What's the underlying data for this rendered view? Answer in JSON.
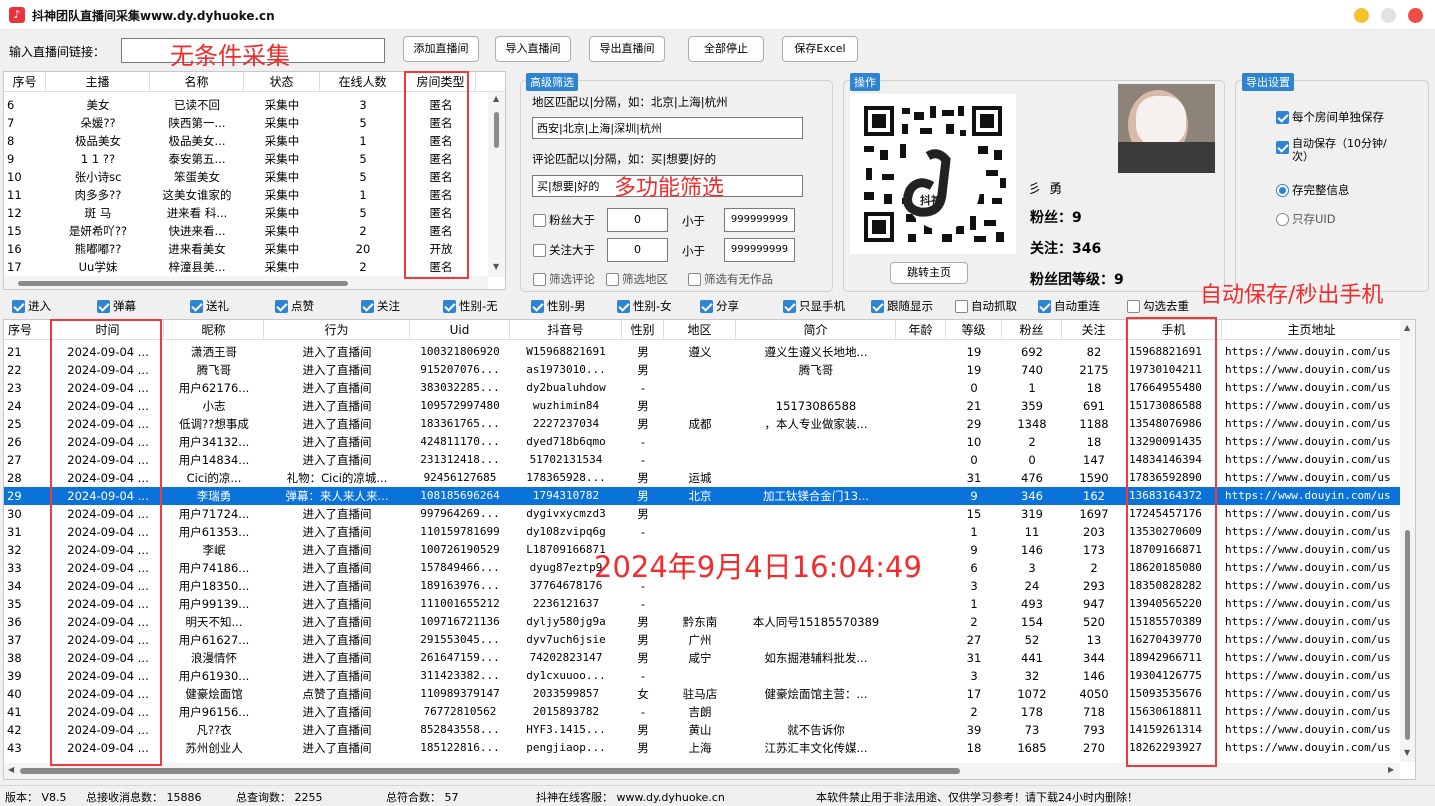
{
  "window": {
    "title": "抖神团队直播间采集www.dy.dyhuoke.cn",
    "icon": "tiktok-icon"
  },
  "top": {
    "input_label": "输入直播间链接：",
    "input_value": "",
    "buttons": [
      "添加直播间",
      "导入直播间",
      "导出直播间",
      "全部停止",
      "保存Excel"
    ]
  },
  "annotations": {
    "a1": "无条件采集",
    "a2": "多功能筛选",
    "a3": "自动保存/秒出手机",
    "a4": "2024年9月4日16:04:49"
  },
  "room_table": {
    "headers": [
      "序号",
      "主播",
      "名称",
      "状态",
      "在线人数",
      "房间类型"
    ],
    "rows": [
      [
        "6",
        "美女",
        "已读不回",
        "采集中",
        "3",
        "匿名"
      ],
      [
        "7",
        "朵媛??",
        "陕西第一...",
        "采集中",
        "5",
        "匿名"
      ],
      [
        "8",
        "极品美女",
        "极品美女...",
        "采集中",
        "1",
        "匿名"
      ],
      [
        "9",
        "1 1  ??",
        "泰安第五...",
        "采集中",
        "5",
        "匿名"
      ],
      [
        "10",
        "张小诗sc",
        "笨蛋美女",
        "采集中",
        "5",
        "匿名"
      ],
      [
        "11",
        "肉多多??",
        "这美女谁家的",
        "采集中",
        "1",
        "匿名"
      ],
      [
        "12",
        "斑 马",
        "进来看 科...",
        "采集中",
        "5",
        "匿名"
      ],
      [
        "15",
        "是妍希吖??",
        "快进来看...",
        "采集中",
        "2",
        "匿名"
      ],
      [
        "16",
        "熊嘟嘟??",
        "进来看美女",
        "采集中",
        "20",
        "开放"
      ],
      [
        "17",
        "Uu学妹",
        "梓潼县美...",
        "采集中",
        "2",
        "匿名"
      ]
    ]
  },
  "filter": {
    "title": "高级筛选",
    "region_hint": "地区匹配以|分隔，如：北京|上海|杭州",
    "region_value": "西安|北京|上海|深圳|杭州",
    "comment_hint": "评论匹配以|分隔，如：买|想要|好的",
    "comment_value": "买|想要|好的",
    "fans_label": "粉丝大于",
    "fans_min": "0",
    "less_label": "小于",
    "fans_max": "999999999",
    "follow_label": "关注大于",
    "follow_min": "0",
    "follow_max": "999999999",
    "opts": [
      "筛选评论",
      "筛选地区",
      "筛选有无作品"
    ]
  },
  "ops": {
    "title": "操作",
    "qr_label": "抖神",
    "name": "勇",
    "fans_label": "粉丝：",
    "fans": "9",
    "follow_label": "关注：",
    "follow": "346",
    "club_label": "粉丝团等级：",
    "club": "9",
    "jump": "跳转主页"
  },
  "export": {
    "title": "导出设置",
    "opt1": "每个房间单独保存",
    "opt2": "自动保存（10分钟/次）",
    "r1": "存完整信息",
    "r2": "只存UID"
  },
  "toggles": [
    {
      "t": "进入",
      "on": true
    },
    {
      "t": "弹幕",
      "on": true
    },
    {
      "t": "送礼",
      "on": true
    },
    {
      "t": "点赞",
      "on": true
    },
    {
      "t": "关注",
      "on": true
    },
    {
      "t": "性别-无",
      "on": true
    },
    {
      "t": "性别-男",
      "on": true
    },
    {
      "t": "性别-女",
      "on": true
    },
    {
      "t": "分享",
      "on": true
    },
    {
      "t": "只显手机",
      "on": true
    },
    {
      "t": "跟随显示",
      "on": true
    },
    {
      "t": "自动抓取",
      "on": false
    },
    {
      "t": "自动重连",
      "on": true
    },
    {
      "t": "勾选去重",
      "on": false
    }
  ],
  "main_table": {
    "headers": [
      "序号",
      "时间",
      "昵称",
      "行为",
      "Uid",
      "抖音号",
      "性别",
      "地区",
      "简介",
      "年龄",
      "等级",
      "粉丝",
      "关注",
      "手机",
      "主页地址"
    ],
    "rows": [
      [
        "21",
        "2024-09-04 ...",
        "潇洒王哥",
        "进入了直播间",
        "100321806920",
        "W15968821691",
        "男",
        "遵义",
        "遵义生遵义长地地...",
        "",
        "19",
        "692",
        "82",
        "15968821691",
        "https://www.douyin.com/us"
      ],
      [
        "22",
        "2024-09-04 ...",
        "腾飞哥",
        "进入了直播间",
        "915207076...",
        "as1973010...",
        "男",
        "",
        "腾飞哥",
        "",
        "19",
        "740",
        "2175",
        "19730104211",
        "https://www.douyin.com/us"
      ],
      [
        "23",
        "2024-09-04 ...",
        "用户62176...",
        "进入了直播间",
        "383032285...",
        "dy2bualuhdow",
        "-",
        "",
        "",
        "",
        "0",
        "1",
        "18",
        "17664955480",
        "https://www.douyin.com/us"
      ],
      [
        "24",
        "2024-09-04 ...",
        "小志",
        "进入了直播间",
        "109572997480",
        "wuzhimin84",
        "男",
        "",
        "15173086588",
        "",
        "21",
        "359",
        "691",
        "15173086588",
        "https://www.douyin.com/us"
      ],
      [
        "25",
        "2024-09-04 ...",
        "低调??想事成",
        "进入了直播间",
        "183361765...",
        "2227237034",
        "男",
        "成都",
        "，本人专业做家装...",
        "",
        "29",
        "1348",
        "1188",
        "13548076986",
        "https://www.douyin.com/us"
      ],
      [
        "26",
        "2024-09-04 ...",
        "用户34132...",
        "进入了直播间",
        "424811170...",
        "dyed718b6qmo",
        "-",
        "",
        "",
        "",
        "10",
        "2",
        "18",
        "13290091435",
        "https://www.douyin.com/us"
      ],
      [
        "27",
        "2024-09-04 ...",
        "用户14834...",
        "进入了直播间",
        "231312418...",
        "51702131534",
        "-",
        "",
        "",
        "",
        "0",
        "0",
        "147",
        "14834146394",
        "https://www.douyin.com/us"
      ],
      [
        "28",
        "2024-09-04 ...",
        "Cici的凉...",
        "礼物：Cici的凉城...",
        "92456127685",
        "178365928...",
        "男",
        "运城",
        "",
        "",
        "31",
        "476",
        "1590",
        "17836592890",
        "https://www.douyin.com/us"
      ],
      [
        "29",
        "2024-09-04 ...",
        "李瑞勇",
        "弹幕：来人来人来...",
        "108185696264",
        "1794310782",
        "男",
        "北京",
        "加工钛镁合金门13...",
        "",
        "9",
        "346",
        "162",
        "13683164372",
        "https://www.douyin.com/us"
      ],
      [
        "30",
        "2024-09-04 ...",
        "用户71724...",
        "进入了直播间",
        "997964269...",
        "dygivxycmzd3",
        "男",
        "",
        "",
        "",
        "15",
        "319",
        "1697",
        "17245457176",
        "https://www.douyin.com/us"
      ],
      [
        "31",
        "2024-09-04 ...",
        "用户61353...",
        "进入了直播间",
        "110159781699",
        "dy108zvipq6g",
        "-",
        "",
        "",
        "",
        "1",
        "11",
        "203",
        "13530270609",
        "https://www.douyin.com/us"
      ],
      [
        "32",
        "2024-09-04 ...",
        "李岷",
        "进入了直播间",
        "100726190529",
        "L18709166871",
        "",
        "",
        "",
        "",
        "9",
        "146",
        "173",
        "18709166871",
        "https://www.douyin.com/us"
      ],
      [
        "33",
        "2024-09-04 ...",
        "用户74186...",
        "进入了直播间",
        "157849466...",
        "dyug87eztp9",
        "",
        "",
        "",
        "",
        "6",
        "3",
        "2",
        "18620185080",
        "https://www.douyin.com/us"
      ],
      [
        "34",
        "2024-09-04 ...",
        "用户18350...",
        "进入了直播间",
        "189163976...",
        "37764678176",
        "-",
        "",
        "",
        "",
        "3",
        "24",
        "293",
        "18350828282",
        "https://www.douyin.com/us"
      ],
      [
        "35",
        "2024-09-04 ...",
        "用户99139...",
        "进入了直播间",
        "111001655212",
        "2236121637",
        "-",
        "",
        "",
        "",
        "1",
        "493",
        "947",
        "13940565220",
        "https://www.douyin.com/us"
      ],
      [
        "36",
        "2024-09-04 ...",
        "明天不知...",
        "进入了直播间",
        "109716721136",
        "dyljy580jg9a",
        "男",
        "黔东南",
        "本人同号15185570389",
        "",
        "2",
        "154",
        "520",
        "15185570389",
        "https://www.douyin.com/us"
      ],
      [
        "37",
        "2024-09-04 ...",
        "用户61627...",
        "进入了直播间",
        "291553045...",
        "dyv7uch6jsie",
        "男",
        "广州",
        "",
        "",
        "27",
        "52",
        "13",
        "16270439770",
        "https://www.douyin.com/us"
      ],
      [
        "38",
        "2024-09-04 ...",
        "浪漫情怀",
        "进入了直播间",
        "261647159...",
        "74202823147",
        "男",
        "咸宁",
        "如东掘港辅料批发...",
        "",
        "31",
        "441",
        "344",
        "18942966711",
        "https://www.douyin.com/us"
      ],
      [
        "39",
        "2024-09-04 ...",
        "用户61930...",
        "进入了直播间",
        "311423382...",
        "dy1cxuuoo...",
        "-",
        "",
        "",
        "",
        "3",
        "32",
        "146",
        "19304126775",
        "https://www.douyin.com/us"
      ],
      [
        "40",
        "2024-09-04 ...",
        "健豪烩面馆",
        "点赞了直播间",
        "110989379147",
        "2033599857",
        "女",
        "驻马店",
        "健豪烩面馆主营：...",
        "",
        "17",
        "1072",
        "4050",
        "15093535676",
        "https://www.douyin.com/us"
      ],
      [
        "41",
        "2024-09-04 ...",
        "用户96156...",
        "进入了直播间",
        "76772810562",
        "2015893782",
        "-",
        "吉朗",
        "",
        "",
        "2",
        "178",
        "718",
        "15630618811",
        "https://www.douyin.com/us"
      ],
      [
        "42",
        "2024-09-04 ...",
        "凡??衣",
        "进入了直播间",
        "852843558...",
        "HYF3.1415...",
        "男",
        "黄山",
        "就不告诉你",
        "",
        "39",
        "73",
        "793",
        "14159261314",
        "https://www.douyin.com/us"
      ],
      [
        "43",
        "2024-09-04 ...",
        "苏州创业人",
        "进入了直播间",
        "185122816...",
        "pengjiaop...",
        "男",
        "上海",
        "江苏汇丰文化传媒...",
        "",
        "18",
        "1685",
        "270",
        "18262293927",
        "https://www.douyin.com/us"
      ]
    ]
  },
  "status": {
    "version": "版本： V8.5",
    "total": "总接收消息数： 15886",
    "query": "总查询数： 2255",
    "match": "总符合数： 57",
    "service": "抖神在线客服： www.dy.dyhuoke.cn",
    "notice": "本软件禁止用于非法用途、仅供学习参考！请下载24小时内删除！"
  }
}
